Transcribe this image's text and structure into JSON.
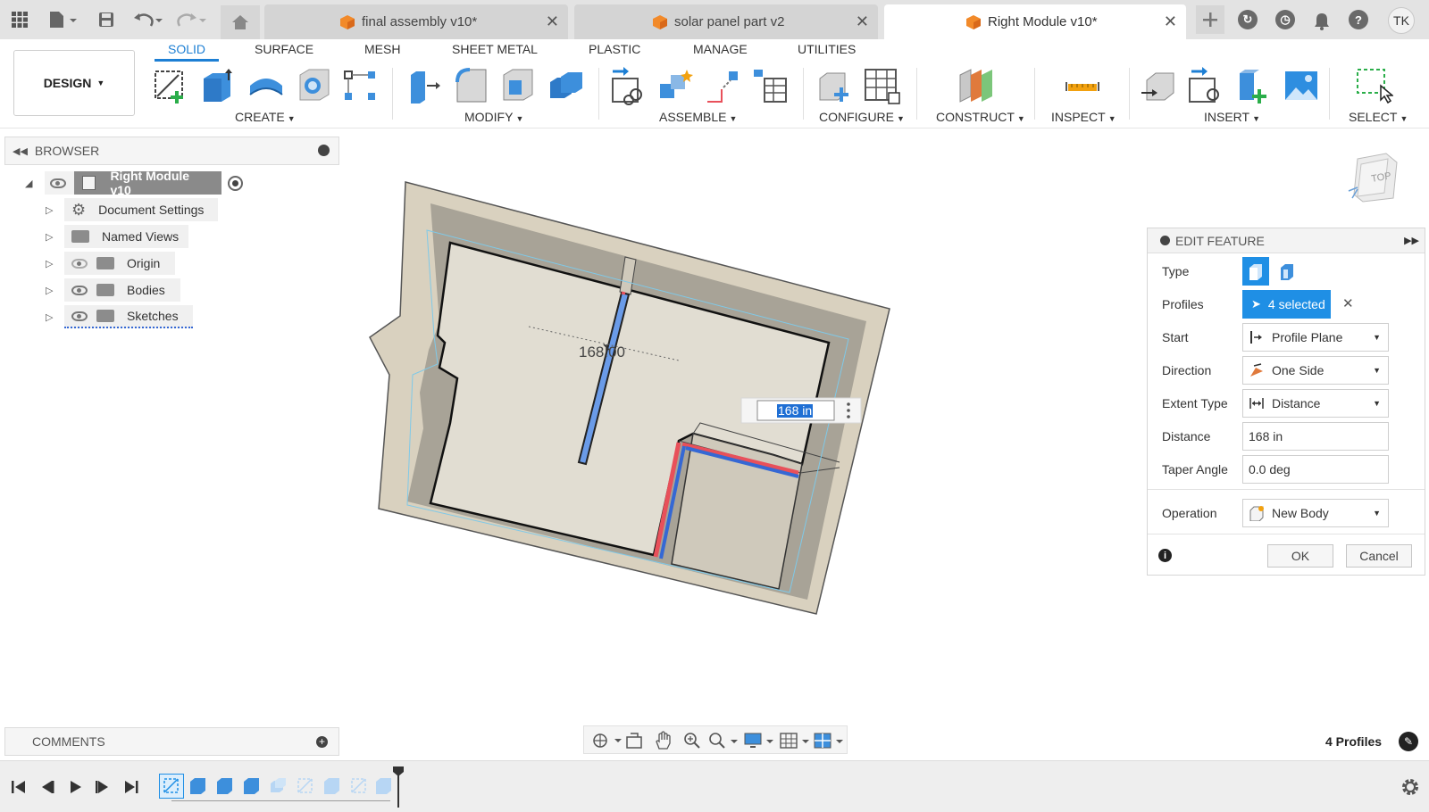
{
  "tabs": [
    {
      "label": "final assembly v10*",
      "active": false
    },
    {
      "label": "solar panel part v2",
      "active": false
    },
    {
      "label": "Right Module v10*",
      "active": true
    }
  ],
  "user": {
    "initials": "TK"
  },
  "workspace": {
    "label": "DESIGN"
  },
  "mode_tabs": [
    "SOLID",
    "SURFACE",
    "MESH",
    "SHEET METAL",
    "PLASTIC",
    "MANAGE",
    "UTILITIES"
  ],
  "tool_groups": [
    "CREATE",
    "MODIFY",
    "ASSEMBLE",
    "CONFIGURE",
    "CONSTRUCT",
    "INSPECT",
    "INSERT",
    "SELECT"
  ],
  "browser": {
    "title": "BROWSER",
    "root": "Right Module v10",
    "items": [
      "Document Settings",
      "Named Views",
      "Origin",
      "Bodies",
      "Sketches"
    ]
  },
  "viewcube": {
    "label": "TOP"
  },
  "canvas": {
    "dimension_label": "168.00",
    "distance_input": "168 in"
  },
  "edit_feature": {
    "title": "EDIT FEATURE",
    "type_label": "Type",
    "profiles_label": "Profiles",
    "profiles_value": "4 selected",
    "start_label": "Start",
    "start_value": "Profile Plane",
    "direction_label": "Direction",
    "direction_value": "One Side",
    "extent_label": "Extent Type",
    "extent_value": "Distance",
    "distance_label": "Distance",
    "distance_value": "168 in",
    "taper_label": "Taper Angle",
    "taper_value": "0.0 deg",
    "operation_label": "Operation",
    "operation_value": "New Body",
    "ok": "OK",
    "cancel": "Cancel"
  },
  "comments": {
    "title": "COMMENTS"
  },
  "status": {
    "profiles_count": "4 Profiles"
  },
  "colors": {
    "accent": "#1f8fe5",
    "selection_red": "#e8505a",
    "part_tan": "#d9d1bf"
  }
}
